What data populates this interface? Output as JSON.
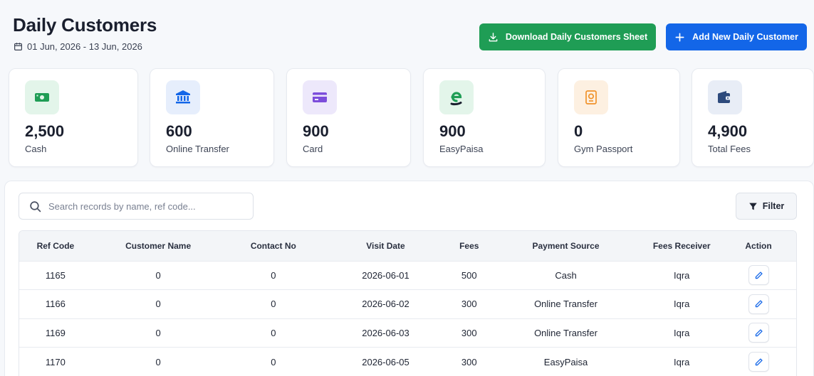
{
  "header": {
    "title": "Daily Customers",
    "date_range": "01 Jun, 2026 - 13 Jun, 2026"
  },
  "actions": {
    "download_label": "Download Daily Customers Sheet",
    "add_label": "Add New Daily Customer"
  },
  "colors": {
    "download": "#1f9d55",
    "add": "#1366e8",
    "edit_icon": "#1366e8"
  },
  "stats": [
    {
      "value": "2,500",
      "label": "Cash",
      "icon": "banknote-icon"
    },
    {
      "value": "600",
      "label": "Online Transfer",
      "icon": "bank-icon"
    },
    {
      "value": "900",
      "label": "Card",
      "icon": "credit-card-icon"
    },
    {
      "value": "900",
      "label": "EasyPaisa",
      "icon": "easypaisa-icon"
    },
    {
      "value": "0",
      "label": "Gym Passport",
      "icon": "passport-icon"
    },
    {
      "value": "4,900",
      "label": "Total Fees",
      "icon": "wallet-icon"
    }
  ],
  "search": {
    "placeholder": "Search records by name, ref code...",
    "value": ""
  },
  "filter_label": "Filter",
  "table": {
    "columns": [
      "Ref Code",
      "Customer Name",
      "Contact No",
      "Visit Date",
      "Fees",
      "Payment Source",
      "Fees Receiver",
      "Action"
    ],
    "rows": [
      [
        "1165",
        "0",
        "0",
        "2026-06-01",
        "500",
        "Cash",
        "Iqra"
      ],
      [
        "1166",
        "0",
        "0",
        "2026-06-02",
        "300",
        "Online Transfer",
        "Iqra"
      ],
      [
        "1169",
        "0",
        "0",
        "2026-06-03",
        "300",
        "Online Transfer",
        "Iqra"
      ],
      [
        "1170",
        "0",
        "0",
        "2026-06-05",
        "300",
        "EasyPaisa",
        "Iqra"
      ]
    ]
  }
}
